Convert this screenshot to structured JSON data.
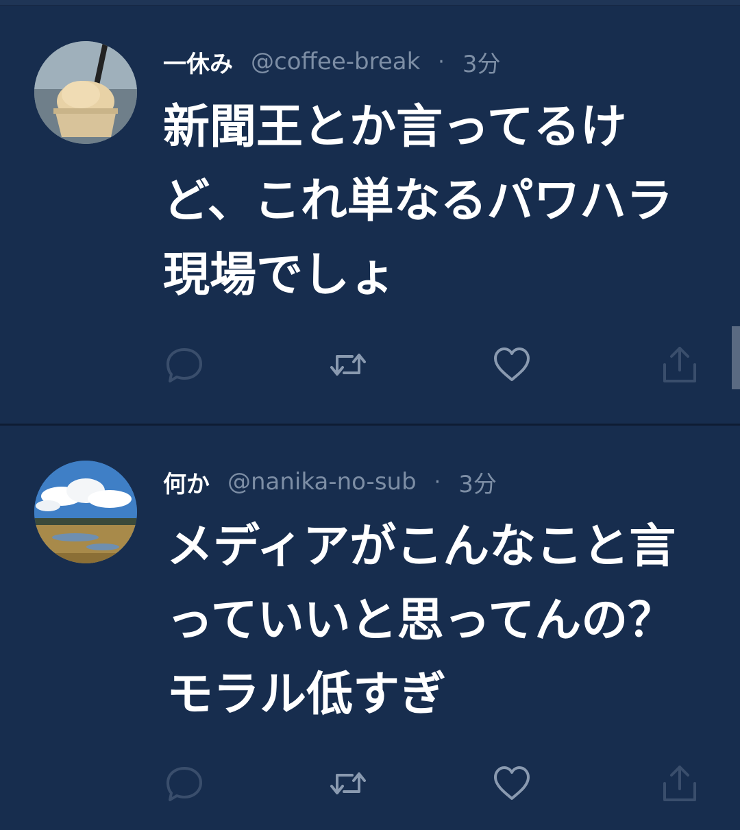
{
  "tweets": [
    {
      "name": "一休み",
      "handle": "@coffee-break",
      "separator": "·",
      "time": "3分",
      "text": "新聞王とか言ってるけ\nど、これ単なるパワハラ\n現場でしょ",
      "avatar": "ice-cream-photo"
    },
    {
      "name": "何か",
      "handle": "@nanika-no-sub",
      "separator": "·",
      "time": "3分",
      "text": "メディアがこんなこと言\nっていいと思ってんの？\nモラル低すぎ",
      "avatar": "landscape-photo"
    }
  ],
  "icons": {
    "reply": "reply-icon",
    "retweet": "retweet-icon",
    "like": "like-icon",
    "share": "share-icon"
  },
  "colors": {
    "background": "#172d4e",
    "secondary_text": "#7d8ea5",
    "icon": "#7d8ea5"
  }
}
